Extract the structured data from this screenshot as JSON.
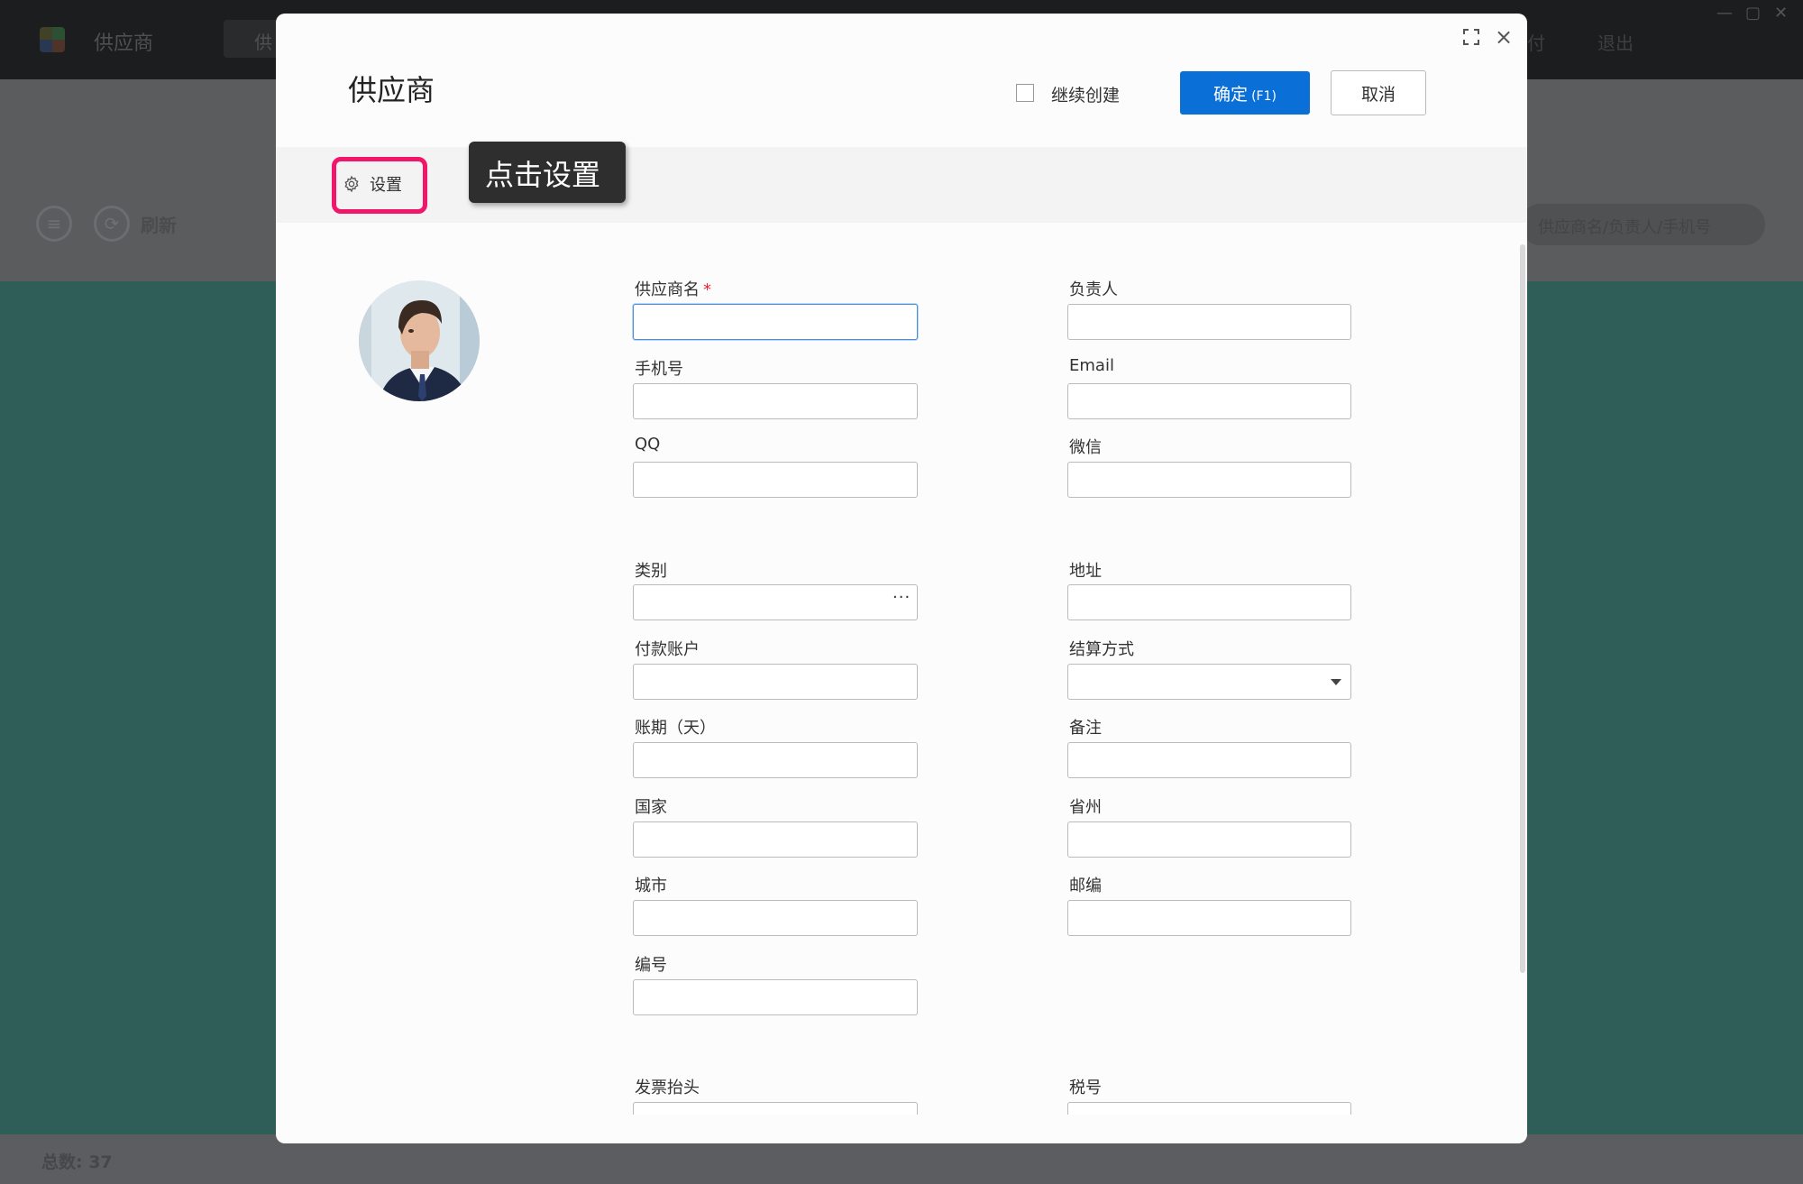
{
  "app": {
    "title": "供应商",
    "tab_label": "供",
    "menu": [
      "付",
      "退出"
    ],
    "toolbar_refresh": "刷新",
    "search_placeholder": "供应商名/负责人/手机号",
    "footer_total": "总数: 37"
  },
  "dialog": {
    "title": "供应商",
    "continue_label": "继续创建",
    "ok_label": "确定",
    "ok_shortcut": "(F1)",
    "cancel_label": "取消",
    "settings_label": "设置",
    "tooltip": "点击设置"
  },
  "form": {
    "supplier_name": "供应商名",
    "manager": "负责人",
    "phone": "手机号",
    "email": "Email",
    "qq": "QQ",
    "wechat": "微信",
    "category": "类别",
    "address": "地址",
    "payment_account": "付款账户",
    "settlement": "结算方式",
    "credit_days": "账期（天）",
    "remark": "备注",
    "country": "国家",
    "province": "省州",
    "city": "城市",
    "postcode": "邮编",
    "code": "编号",
    "invoice_title": "发票抬头",
    "tax_id": "税号"
  }
}
